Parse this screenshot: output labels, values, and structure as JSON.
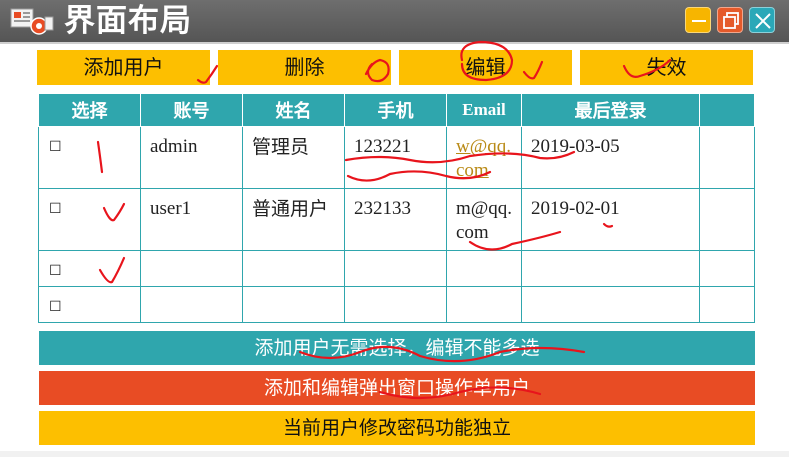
{
  "window": {
    "title": "界面布局",
    "icons": {
      "app": "slides-app-icon",
      "minimize": "minimize-icon",
      "maximize": "maximize-icon",
      "close": "close-icon"
    },
    "colors": {
      "titlebar": "#5f5f5f",
      "minimize": "#f7b500",
      "maximize": "#e55a2a",
      "close": "#2aa8b8"
    }
  },
  "toolbar": {
    "add_label": "添加用户",
    "delete_label": "删除",
    "edit_label": "编辑",
    "disable_label": "失效",
    "color": "#fdbf00"
  },
  "table": {
    "headers": [
      "选择",
      "账号",
      "姓名",
      "手机",
      "Email",
      "最后登录",
      ""
    ],
    "rows": [
      {
        "checkbox": "☐",
        "account": "admin",
        "name": "管理员",
        "phone": "123221",
        "email": "w@qq.com",
        "last_login": "2019-03-05",
        "extra": ""
      },
      {
        "checkbox": "☐",
        "account": "user1",
        "name": "普通用户",
        "phone": "232133",
        "email": "m@qq.com",
        "last_login": "2019-02-01",
        "extra": ""
      },
      {
        "checkbox": "☐",
        "account": "",
        "name": "",
        "phone": "",
        "email": "",
        "last_login": "",
        "extra": ""
      },
      {
        "checkbox": "☐",
        "account": "",
        "name": "",
        "phone": "",
        "email": "",
        "last_login": "",
        "extra": ""
      }
    ],
    "header_color": "#2fa6ad"
  },
  "notes": [
    {
      "text": "添加用户无需选择，编辑不能多选",
      "color": "#2fa6ad"
    },
    {
      "text": "添加和编辑弹出窗口操作单用户",
      "color": "#e84c24"
    },
    {
      "text": "当前用户修改密码功能独立",
      "color": "#fdbf00"
    }
  ],
  "annotation_color": "#e8141c"
}
